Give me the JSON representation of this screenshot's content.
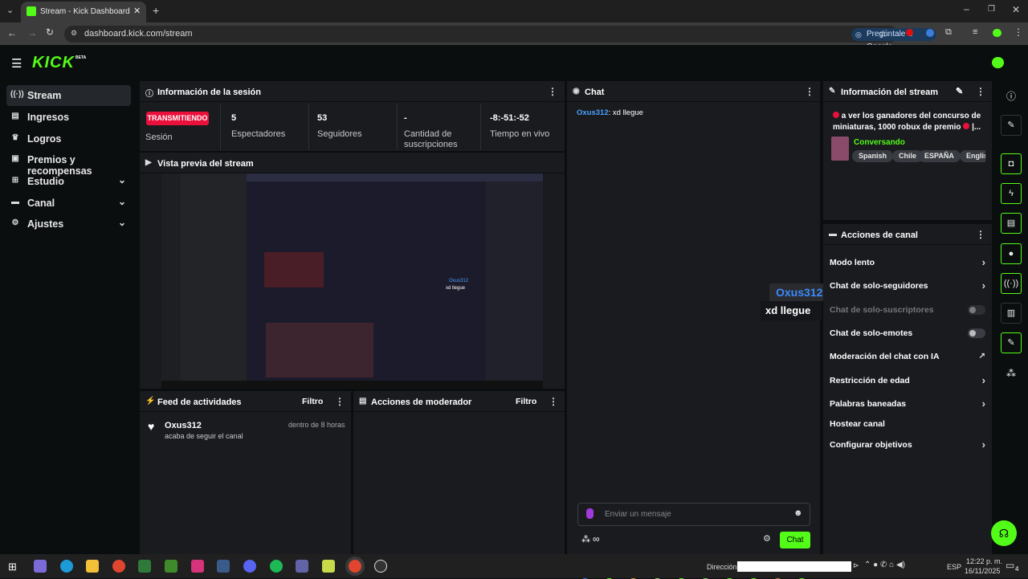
{
  "browser": {
    "tab_title": "Stream - Kick Dashboard",
    "url": "dashboard.kick.com/stream",
    "google_btn": "Pregúntale a Google"
  },
  "brand": {
    "logo": "KICK",
    "badge": "BETA",
    "accent": "#53fc18"
  },
  "sidebar": {
    "items": [
      {
        "icon": "broadcast-icon",
        "label": "Stream"
      },
      {
        "icon": "income-icon",
        "label": "Ingresos"
      },
      {
        "icon": "trophy-icon",
        "label": "Logros"
      },
      {
        "icon": "gift-icon",
        "label": "Premios y recompensas"
      },
      {
        "icon": "studio-icon",
        "label": "Estudio"
      },
      {
        "icon": "channel-icon",
        "label": "Canal"
      },
      {
        "icon": "gear-icon",
        "label": "Ajustes"
      }
    ]
  },
  "session": {
    "title": "Información de la sesión",
    "live_badge": "TRANSMITIENDO",
    "session_label": "Sesión",
    "stats": [
      {
        "value": "5",
        "label": "Espectadores"
      },
      {
        "value": "53",
        "label": "Seguidores"
      },
      {
        "value": "-",
        "label": "Cantidad de suscripciones"
      },
      {
        "value": "-8:-51:-52",
        "label": "Tiempo en vivo"
      }
    ]
  },
  "preview": {
    "title": "Vista previa del stream",
    "overlay_user": "Oxus312",
    "overlay_msg": "xd llegue"
  },
  "activity": {
    "title": "Feed de actividades",
    "filter": "Filtro",
    "items": [
      {
        "user": "Oxus312",
        "action": "acaba de seguir el canal",
        "time": "dentro de 8 horas"
      }
    ]
  },
  "modactions": {
    "title": "Acciones de moderador",
    "filter": "Filtro"
  },
  "chat": {
    "title": "Chat",
    "messages": [
      {
        "user": "Oxus312",
        "text": ": xd llegue"
      }
    ],
    "placeholder": "Enviar un mensaje",
    "send": "Chat"
  },
  "overlay": {
    "user": "Oxus312",
    "msg": "xd llegue"
  },
  "streaminfo": {
    "title": "Información del stream",
    "stream_title": "a ver los ganadores del concurso de miniaturas, 1000 robux de premio",
    "ellipsis": "|...",
    "category": "Conversando",
    "tags": [
      "Spanish",
      "Chile",
      "ESPAÑA",
      "English"
    ]
  },
  "channel_actions": {
    "title": "Acciones de canal",
    "items": [
      {
        "label": "Modo lento",
        "control": "arrow"
      },
      {
        "label": "Chat de solo-seguidores",
        "control": "arrow"
      },
      {
        "label": "Chat de solo-suscriptores",
        "control": "toggle"
      },
      {
        "label": "Chat de solo-emotes",
        "control": "toggle"
      },
      {
        "label": "Moderación del chat con IA",
        "control": "external"
      },
      {
        "label": "Restricción de edad",
        "control": "arrow"
      },
      {
        "label": "Palabras baneadas",
        "control": "arrow"
      },
      {
        "label": "Hostear canal",
        "control": "none"
      },
      {
        "label": "Configurar objetivos",
        "control": "arrow"
      }
    ]
  },
  "taskbar": {
    "address_label": "Dirección",
    "lang": "ESP",
    "time": "12:22 p. m.",
    "date": "16/11/2025",
    "notif": "4"
  }
}
